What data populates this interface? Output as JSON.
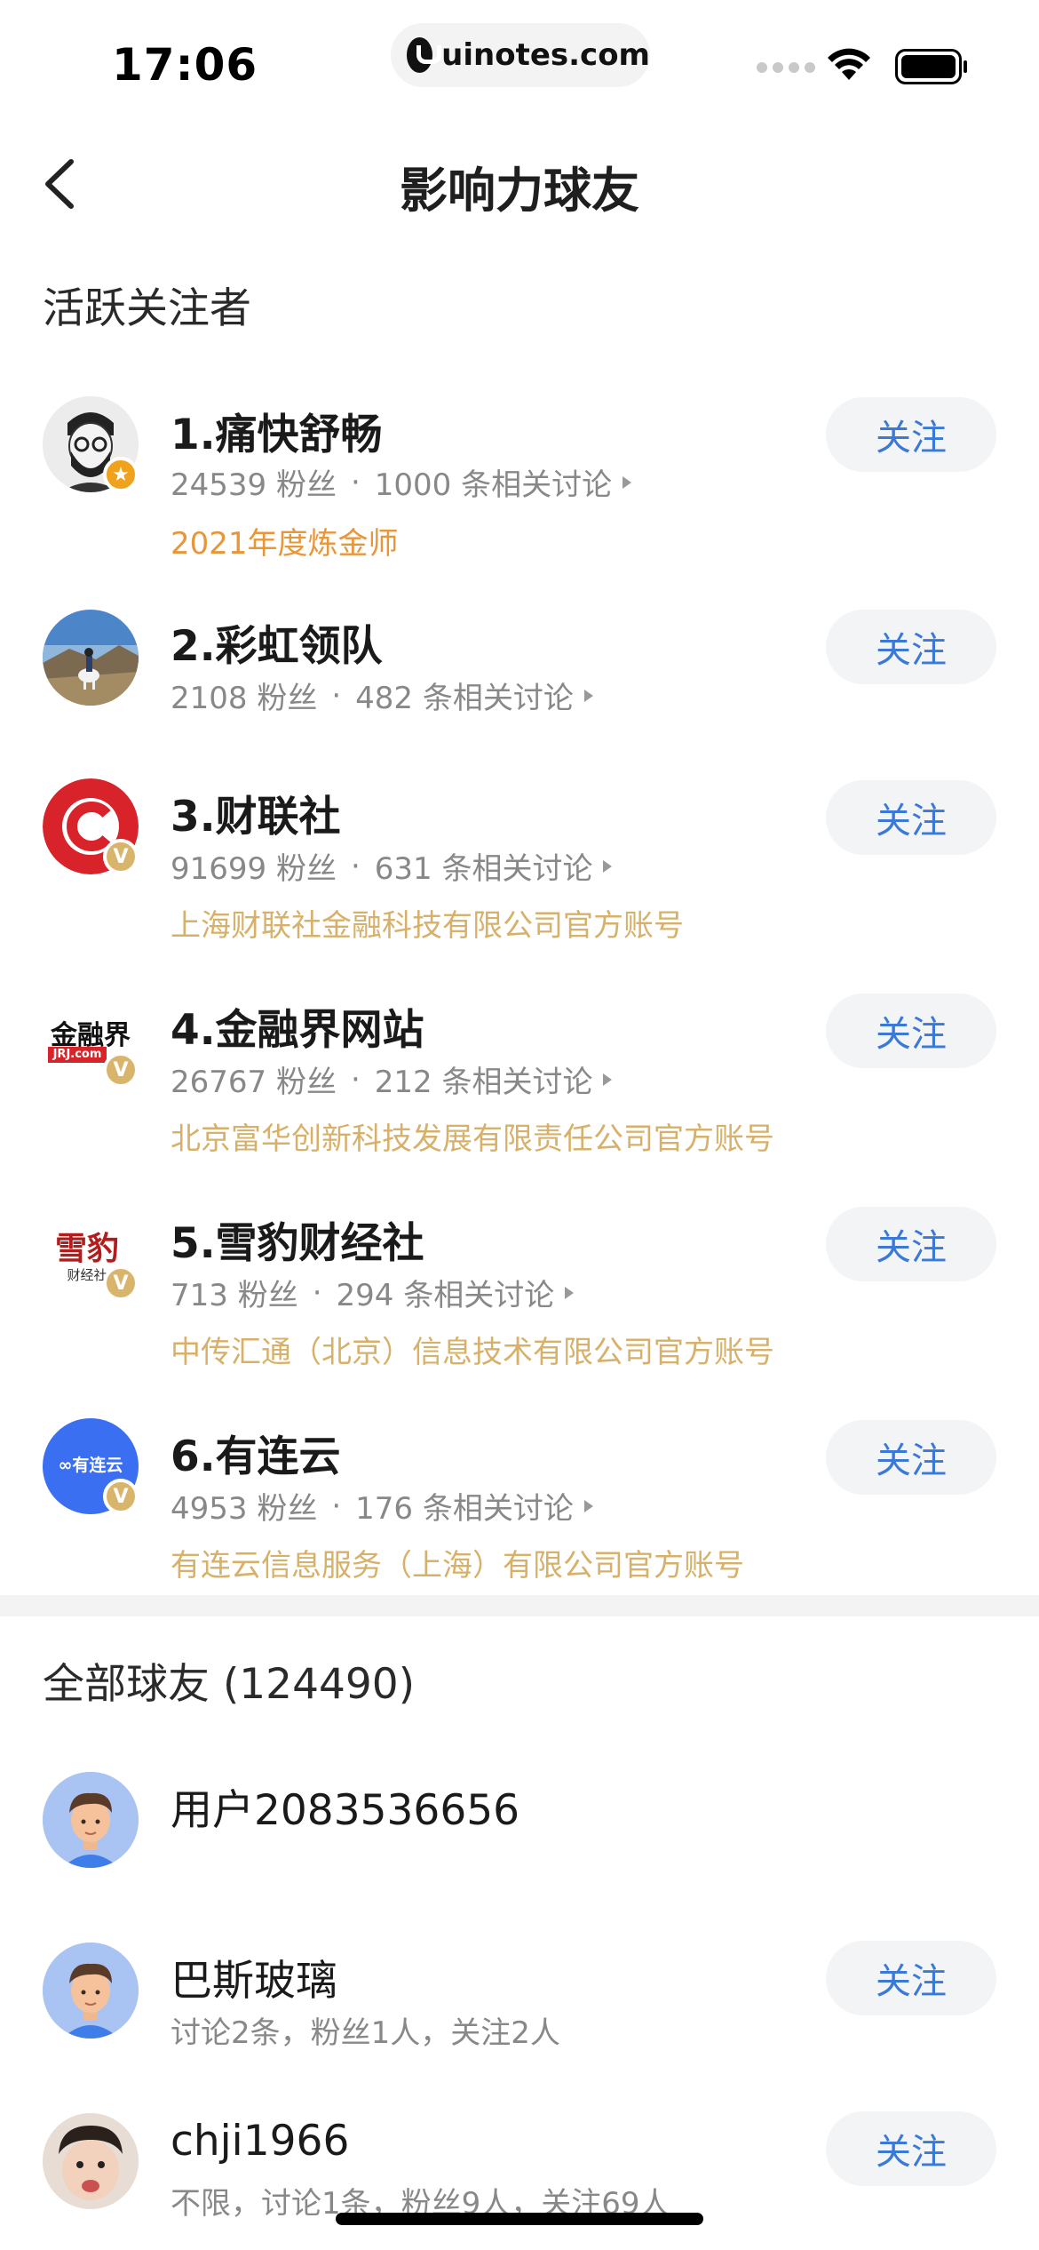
{
  "status_bar": {
    "time": "17:06",
    "url": "uinotes.com"
  },
  "nav": {
    "title": "影响力球友"
  },
  "active_section": {
    "title": "活跃关注者",
    "items": [
      {
        "name": "1.痛快舒畅",
        "fans": "24539 粉丝",
        "sep": "·",
        "discussions": "1000 条相关讨论",
        "subtitle": "2021年度炼金师",
        "follow_label": "关注",
        "badge": "star"
      },
      {
        "name": "2.彩虹领队",
        "fans": "2108 粉丝",
        "sep": "·",
        "discussions": "482 条相关讨论",
        "subtitle": "",
        "follow_label": "关注",
        "badge": ""
      },
      {
        "name": "3.财联社",
        "fans": "91699 粉丝",
        "sep": "·",
        "discussions": "631 条相关讨论",
        "subtitle": "上海财联社金融科技有限公司官方账号",
        "follow_label": "关注",
        "badge": "V"
      },
      {
        "name": "4.金融界网站",
        "fans": "26767 粉丝",
        "sep": "·",
        "discussions": "212 条相关讨论",
        "subtitle": "北京富华创新科技发展有限责任公司官方账号",
        "follow_label": "关注",
        "badge": "V",
        "logo_text": "金融界",
        "logo_sub": "JRJ.com"
      },
      {
        "name": "5.雪豹财经社",
        "fans": "713 粉丝",
        "sep": "·",
        "discussions": "294 条相关讨论",
        "subtitle": "中传汇通（北京）信息技术有限公司官方账号",
        "follow_label": "关注",
        "badge": "V",
        "logo_text": "雪豹",
        "logo_sub": "财经社"
      },
      {
        "name": "6.有连云",
        "fans": "4953 粉丝",
        "sep": "·",
        "discussions": "176 条相关讨论",
        "subtitle": "有连云信息服务（上海）有限公司官方账号",
        "follow_label": "关注",
        "badge": "V",
        "logo_text": "∞有连云"
      }
    ]
  },
  "all_section": {
    "title": "全部球友 (124490)",
    "items": [
      {
        "name": "用户2083536656",
        "desc": "",
        "follow_label": ""
      },
      {
        "name": "巴斯玻璃",
        "desc": "讨论2条，粉丝1人，关注2人",
        "follow_label": "关注"
      },
      {
        "name": "chji1966",
        "desc": "不限，讨论1条，粉丝9人，关注69人",
        "follow_label": "关注"
      }
    ]
  },
  "colors": {
    "accent_blue": "#3b79d7",
    "gold": "#d7b069",
    "orange": "#e8963a",
    "caixin_red": "#d8232a",
    "youlianyun_blue": "#3a6ff2"
  }
}
